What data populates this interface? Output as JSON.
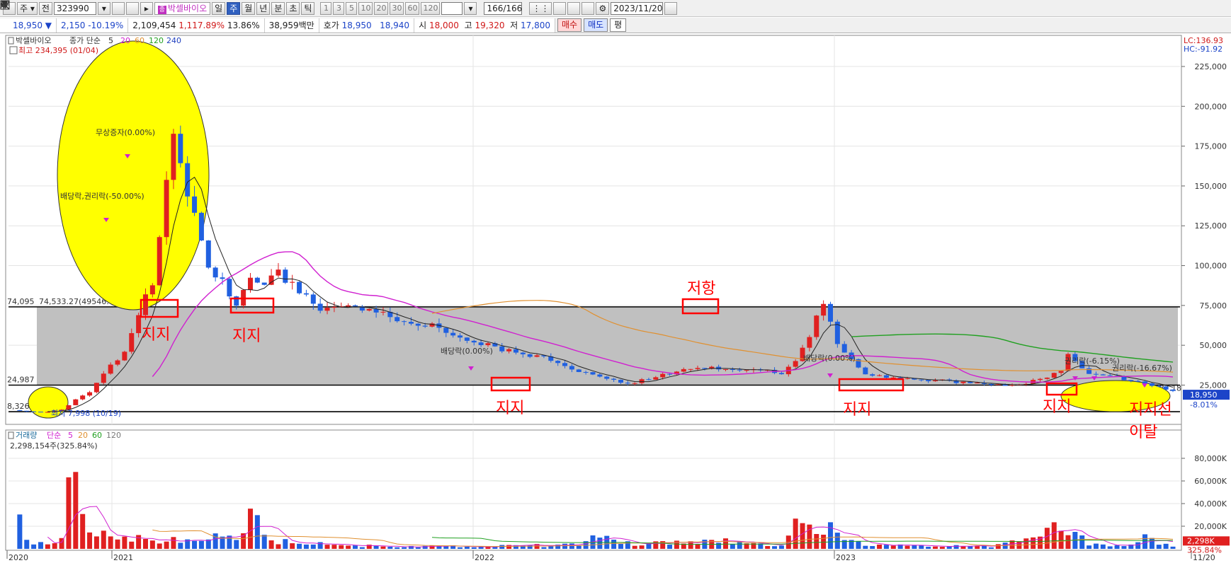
{
  "toolbar": {
    "mode_label": "주",
    "jeon_label": "전",
    "stock_code": "323990",
    "stock_name": "박셀바이오",
    "periods": [
      "일",
      "주",
      "월",
      "년",
      "분",
      "초",
      "틱"
    ],
    "active_period": "주",
    "intervals": [
      "1",
      "3",
      "5",
      "10",
      "20",
      "30",
      "60",
      "120"
    ],
    "count": "166/166",
    "date": "2023/11/20"
  },
  "quote": {
    "price": "18,950 ▼",
    "change": "2,150",
    "change_pct": "-10.19%",
    "volume": "2,109,454",
    "volume_ratio": "1,117.89%",
    "turnover": "13.86%",
    "amount": "38,959백만",
    "bid_label": "호가",
    "ask": "18,950",
    "bid": "18,940",
    "open_label": "시",
    "open": "18,000",
    "high_label": "고",
    "high": "19,320",
    "low_label": "저",
    "low": "17,800",
    "buy_label": "매수",
    "sell_label": "매도",
    "avg_label": "평"
  },
  "colors": {
    "up": "#e02020",
    "down": "#2060e0",
    "ma5": "#222222",
    "ma20": "#d020d0",
    "ma60": "#e09030",
    "ma120": "#20a020",
    "band": "#c0c0c0",
    "highlight": "#ffff00",
    "annot": "#ff0000"
  },
  "chart_data": {
    "type": "candlestick",
    "price_panel": {
      "legend": {
        "name": "박셀바이오",
        "series": "종가 단순",
        "periods": [
          "5",
          "20",
          "60",
          "120",
          "240"
        ]
      },
      "y_ticks": [
        25000,
        50000,
        75000,
        100000,
        125000,
        150000,
        175000,
        200000,
        225000
      ],
      "y_tick_labels": [
        "25,000",
        "50,000",
        "75,000",
        "100,000",
        "125,000",
        "150,000",
        "175,000",
        "200,000",
        "225,000"
      ],
      "x_labels": [
        "2020",
        "2021",
        "2022",
        "2023",
        "11/20"
      ],
      "lc_label": "LC:136.93",
      "hc_label": "HC:-91.92",
      "max_label": "최고 234,395 (01/04)",
      "min_label": "최저 7,998 (10/19)",
      "current_label": "18,950",
      "current_pct": "-8.01%",
      "h_lines": [
        {
          "value": 74095,
          "label": "74,095"
        },
        {
          "value": 24987,
          "label": "24,987"
        },
        {
          "value": 8326,
          "label": "8,326"
        }
      ],
      "hline_annot_1": "74,533.27(49546.09)",
      "hline_annot_2": "24,987.18",
      "events": [
        {
          "label": "무상증자(0.00%)"
        },
        {
          "label": "배당락,권리락(-50.00%)"
        },
        {
          "label": "배당락(0.00%)"
        },
        {
          "label": "배당락(0.00%)"
        },
        {
          "label": "권리락(-6.15%)"
        },
        {
          "label": "권리락(-16.67%)"
        }
      ],
      "annotations": [
        "지지",
        "지지",
        "지지",
        "저항",
        "지지",
        "지지",
        "지지선",
        "이탈"
      ]
    },
    "volume_panel": {
      "legend": {
        "name": "거래량",
        "series": "단순",
        "periods": [
          "5",
          "20",
          "60",
          "120"
        ]
      },
      "latest_label": "2,298,154주(325.84%)",
      "y_ticks": [
        20000,
        40000,
        60000,
        80000
      ],
      "y_tick_labels": [
        "20,000K",
        "40,000K",
        "60,000K",
        "80,000K"
      ],
      "current_label": "2,298K",
      "current_pct": "325.84%"
    }
  }
}
